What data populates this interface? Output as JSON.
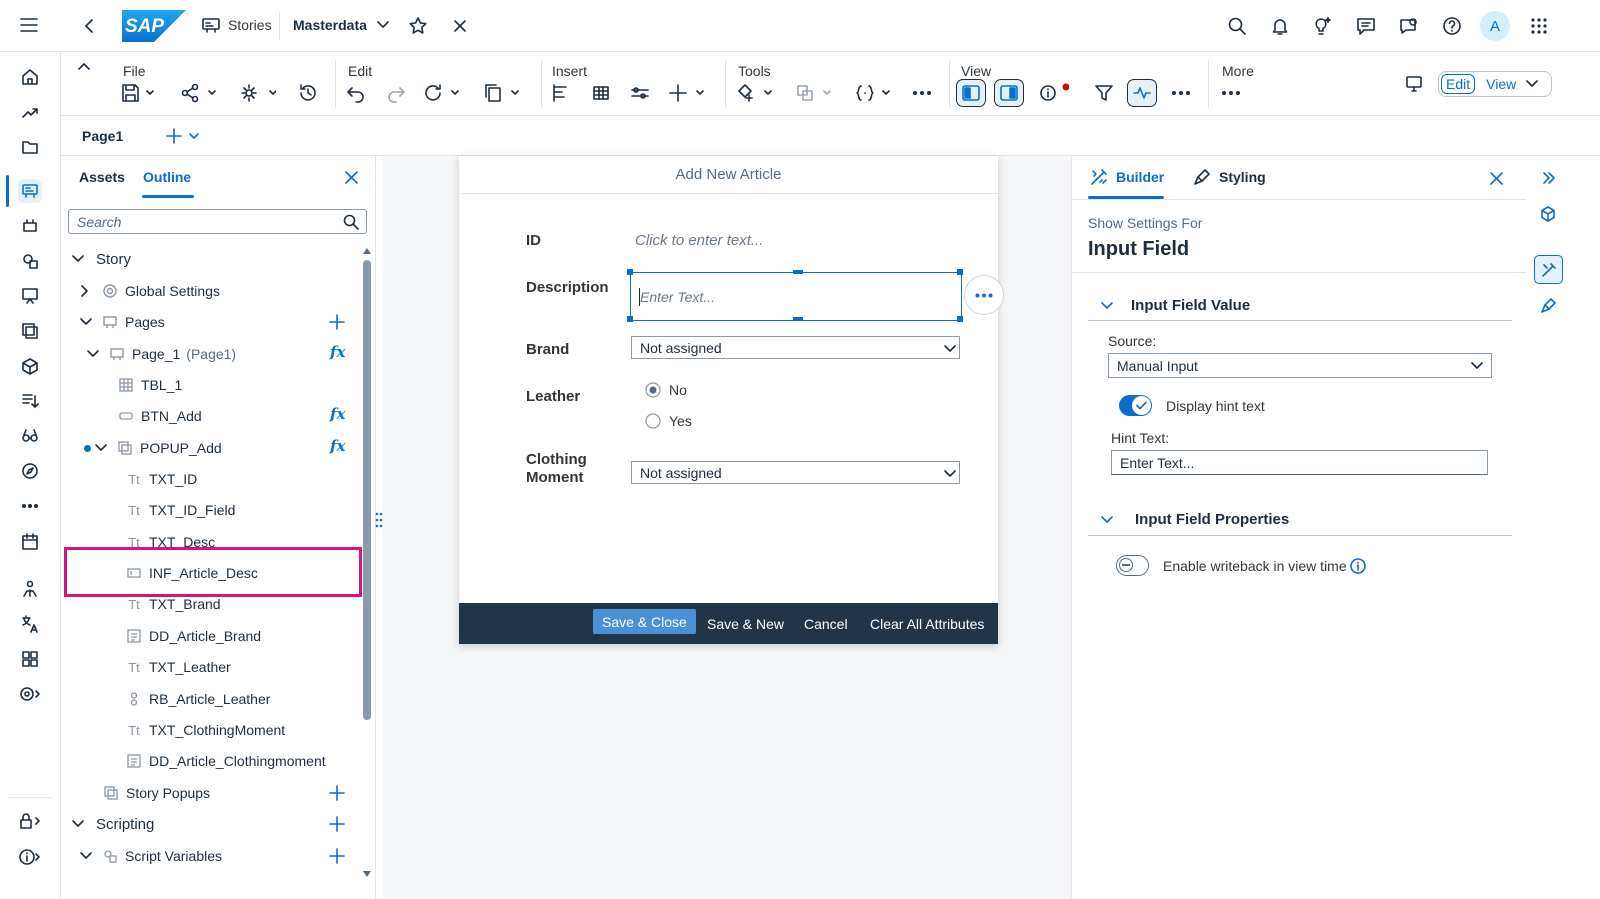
{
  "shell": {
    "brand": "SAP",
    "stories_label": "Stories",
    "story_title": "Masterdata",
    "avatar_letter": "A"
  },
  "toolbar": {
    "file_label": "File",
    "edit_label": "Edit",
    "insert_label": "Insert",
    "tools_label": "Tools",
    "view_label": "View",
    "more_label": "More",
    "edit_mode_button": "Edit",
    "view_mode_button": "View"
  },
  "pagebar": {
    "page_tab": "Page1"
  },
  "left_panel": {
    "tab_assets": "Assets",
    "tab_outline": "Outline",
    "search_placeholder": "Search",
    "tree": [
      {
        "label": "Story",
        "suffix": ""
      },
      {
        "label": "Global Settings",
        "suffix": ""
      },
      {
        "label": "Pages",
        "suffix": ""
      },
      {
        "label": "Page_1",
        "suffix": "(Page1)"
      },
      {
        "label": "TBL_1",
        "suffix": ""
      },
      {
        "label": "BTN_Add",
        "suffix": ""
      },
      {
        "label": "POPUP_Add",
        "suffix": ""
      },
      {
        "label": "TXT_ID",
        "suffix": ""
      },
      {
        "label": "TXT_ID_Field",
        "suffix": ""
      },
      {
        "label": "TXT_Desc",
        "suffix": ""
      },
      {
        "label": "INF_Article_Desc",
        "suffix": ""
      },
      {
        "label": "TXT_Brand",
        "suffix": ""
      },
      {
        "label": "DD_Article_Brand",
        "suffix": ""
      },
      {
        "label": "TXT_Leather",
        "suffix": ""
      },
      {
        "label": "RB_Article_Leather",
        "suffix": ""
      },
      {
        "label": "TXT_ClothingMoment",
        "suffix": ""
      },
      {
        "label": "DD_Article_Clothingmoment",
        "suffix": ""
      },
      {
        "label": "Story Popups",
        "suffix": ""
      },
      {
        "label": "Scripting",
        "suffix": ""
      },
      {
        "label": "Script Variables",
        "suffix": ""
      }
    ],
    "tt_glyph": "Tt",
    "highlight_color": "#d6147e"
  },
  "popup": {
    "title": "Add New Article",
    "id_label": "ID",
    "id_placeholder": "Click to enter text...",
    "description_label": "Description",
    "description_placeholder": "Enter Text...",
    "brand_label": "Brand",
    "brand_value": "Not assigned",
    "leather_label": "Leather",
    "leather_options": [
      "No",
      "Yes"
    ],
    "leather_selected": "No",
    "clothing_label_1": "Clothing",
    "clothing_label_2": "Moment",
    "clothing_value": "Not assigned",
    "footer": {
      "save_close": "Save & Close",
      "save_new": "Save & New",
      "cancel": "Cancel",
      "clear_all": "Clear All Attributes"
    },
    "footer_color": "#223548",
    "primary_color": "#4b8fd4"
  },
  "right_panel": {
    "tab_builder": "Builder",
    "tab_styling": "Styling",
    "show_settings_for": "Show Settings For",
    "component_title": "Input Field",
    "section_value": "Input Field Value",
    "source_label": "Source:",
    "source_value": "Manual Input",
    "display_hint_label": "Display hint text",
    "display_hint_on": true,
    "hint_text_label": "Hint Text:",
    "hint_text_value": "Enter Text...",
    "section_properties": "Input Field Properties",
    "writeback_label": "Enable writeback in view time",
    "writeback_on": false
  },
  "accent_color": "#0a6ed1"
}
